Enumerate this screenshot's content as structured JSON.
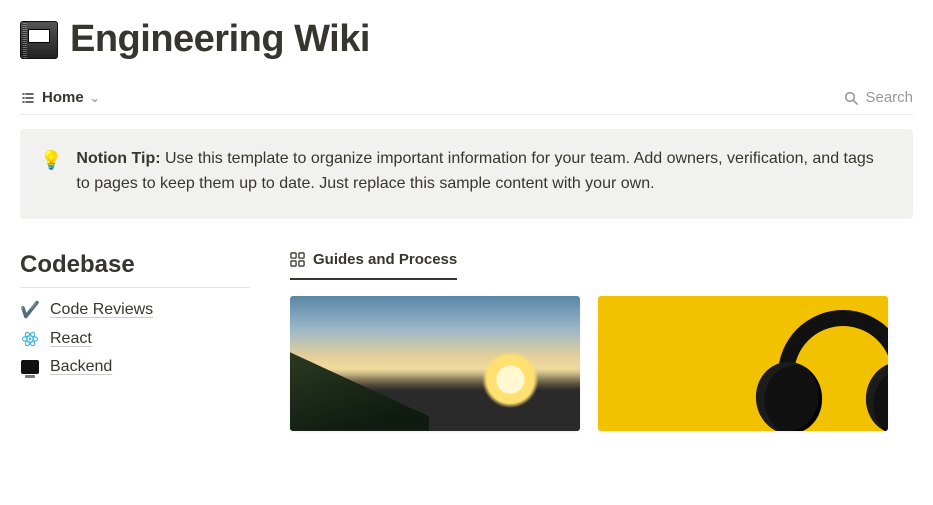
{
  "page": {
    "icon": "notebook-icon",
    "title": "Engineering Wiki"
  },
  "toolbar": {
    "view_label": "Home",
    "search_label": "Search"
  },
  "callout": {
    "icon": "bulb-icon",
    "prefix": "Notion Tip:",
    "body": " Use this template to organize important information for your team. Add owners, verification, and tags to pages to keep them up to date. Just replace this sample content with your own."
  },
  "sidebar": {
    "heading": "Codebase",
    "items": [
      {
        "icon": "check-icon",
        "label": "Code Reviews"
      },
      {
        "icon": "react-icon",
        "label": "React"
      },
      {
        "icon": "monitor-icon",
        "label": "Backend"
      }
    ]
  },
  "gallery": {
    "tab_label": "Guides and Process",
    "cards": [
      {
        "image": "sunset-road"
      },
      {
        "image": "yellow-headphones"
      }
    ]
  }
}
